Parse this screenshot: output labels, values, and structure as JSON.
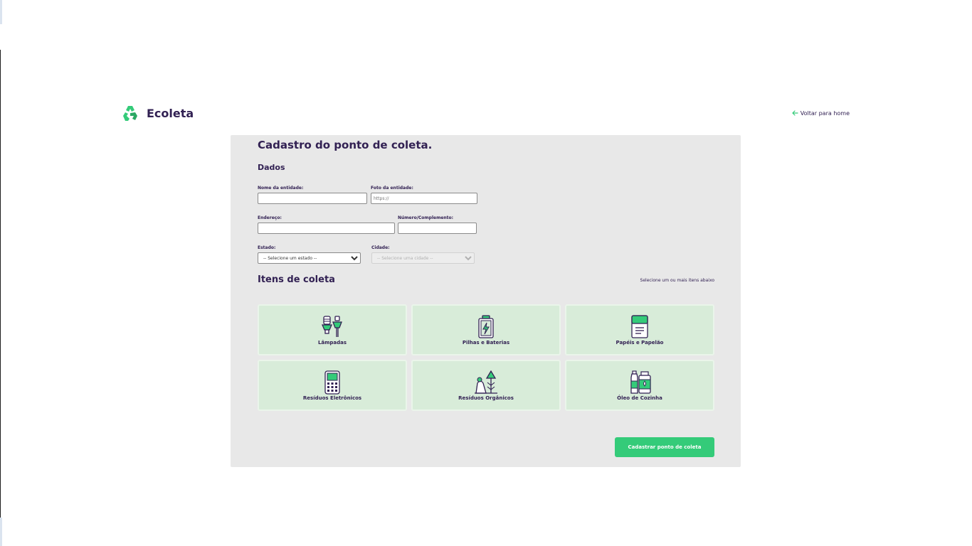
{
  "brand": {
    "name": "Ecoleta",
    "logo_icon": "recycle-icon",
    "accent": "#34cb79",
    "text_color": "#322153"
  },
  "nav": {
    "back_label": "Voltar para home",
    "back_icon": "arrow-left-icon"
  },
  "form": {
    "title": "Cadastro do ponto de coleta.",
    "section_dados": "Dados",
    "fields": {
      "nome": {
        "label": "Nome da entidade:",
        "value": "",
        "placeholder": ""
      },
      "foto": {
        "label": "Foto da entidade:",
        "value": "",
        "placeholder": "https://"
      },
      "endereco": {
        "label": "Endereço:",
        "value": "",
        "placeholder": ""
      },
      "numero": {
        "label": "Número/Complemento:",
        "value": "",
        "placeholder": ""
      },
      "estado": {
        "label": "Estado:",
        "selected": "-- Selecione um estado --"
      },
      "cidade": {
        "label": "Cidade:",
        "selected": "-- Selecione uma cidade --"
      }
    },
    "items_title": "Itens de coleta",
    "items_hint": "Selecione um ou mais itens abaixo",
    "items": [
      {
        "label": "Lâmpadas",
        "icon": "lamp-icon"
      },
      {
        "label": "Pilhas e Baterias",
        "icon": "battery-icon"
      },
      {
        "label": "Papéis e Papelão",
        "icon": "paper-icon"
      },
      {
        "label": "Resíduos Eletrônicos",
        "icon": "electronics-icon"
      },
      {
        "label": "Resíduos Orgânicos",
        "icon": "organic-icon"
      },
      {
        "label": "Óleo de Cozinha",
        "icon": "oil-icon"
      }
    ],
    "submit_label": "Cadastrar ponto de coleta"
  }
}
